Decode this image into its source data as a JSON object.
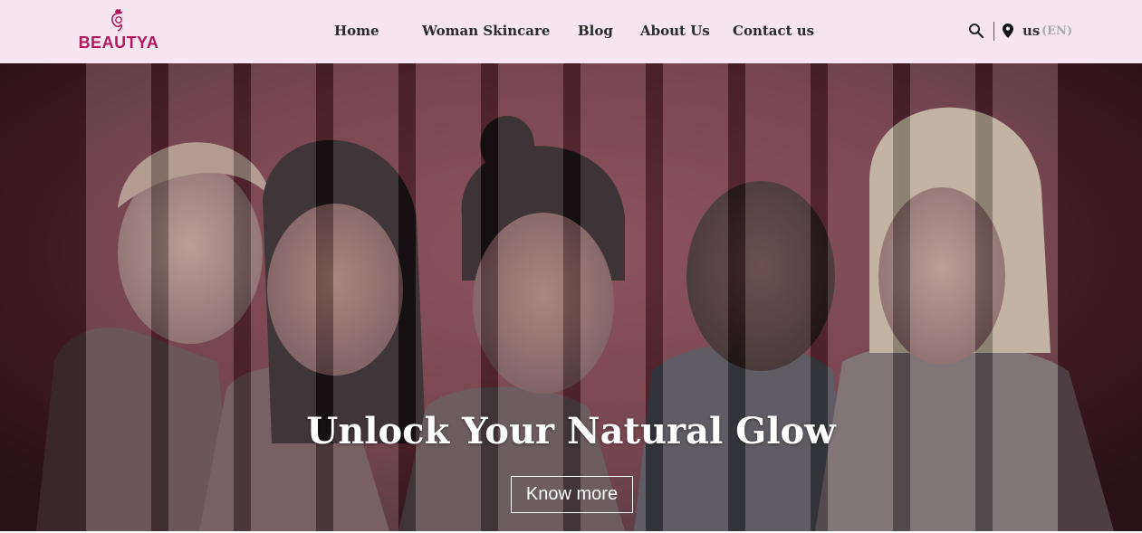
{
  "brand": {
    "name": "BEAUTYA",
    "color": "#b0195e",
    "logo_icon": "flower-face-icon"
  },
  "header": {
    "background": "#f7e6ef",
    "nav": [
      {
        "label": "Home"
      },
      {
        "label": "Woman Skincare"
      },
      {
        "label": "Blog"
      },
      {
        "label": "About Us"
      },
      {
        "label": "Contact us"
      }
    ],
    "search_icon": "search-icon",
    "location_icon": "map-pin-icon",
    "locale": {
      "country": "us",
      "language": "(EN)"
    }
  },
  "hero": {
    "title": "Unlock Your Natural Glow",
    "cta_label": "Know more",
    "image": "group portrait of five smiling women with varied skin tones against a rose background",
    "overlay_colors": {
      "base": "#3b1a22",
      "accent": "#8a3f4d"
    }
  }
}
